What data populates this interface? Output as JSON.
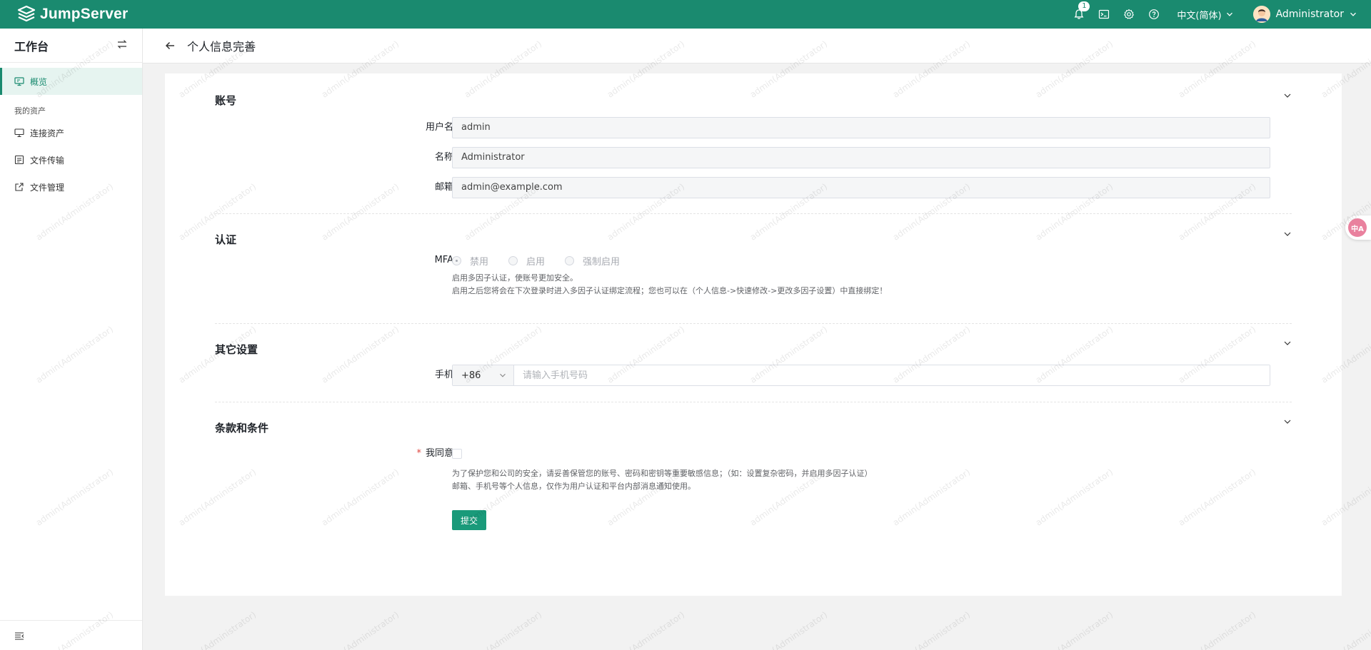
{
  "app": {
    "brand": "JumpServer",
    "accent_color": "#1a8a6f",
    "notification_count": "1",
    "language": "中文(简体)",
    "user_name": "Administrator",
    "icons": [
      "bell-icon",
      "terminal-icon",
      "gear-icon",
      "help-icon",
      "chevron-down-icon"
    ]
  },
  "sidebar": {
    "title": "工作台",
    "items": [
      {
        "label": "概览",
        "active": true,
        "icon": "monitor-icon"
      }
    ],
    "group_label": "我的资产",
    "group_items": [
      {
        "label": "连接资产",
        "icon": "desktop-icon"
      },
      {
        "label": "文件传输",
        "icon": "file-transfer-icon"
      },
      {
        "label": "文件管理",
        "icon": "external-link-icon"
      }
    ]
  },
  "page": {
    "title": "个人信息完善"
  },
  "sections": {
    "account": {
      "title": "账号",
      "username_label": "用户名",
      "username_value": "admin",
      "name_label": "名称",
      "name_value": "Administrator",
      "email_label": "邮箱",
      "email_value": "admin@example.com"
    },
    "auth": {
      "title": "认证",
      "mfa_label": "MFA",
      "options": [
        "禁用",
        "启用",
        "强制启用"
      ],
      "selected": "禁用",
      "help_line1": "启用多因子认证，使账号更加安全。",
      "help_line2": "启用之后您将会在下次登录时进入多因子认证绑定流程；您也可以在（个人信息->快速修改->更改多因子设置）中直接绑定！"
    },
    "other": {
      "title": "其它设置",
      "phone_label": "手机",
      "country_code": "+86",
      "phone_placeholder": "请输入手机号码"
    },
    "terms": {
      "title": "条款和条件",
      "agree_required_mark": "*",
      "agree_label": "我同意",
      "agree_checked": false,
      "help_line1": "为了保护您和公司的安全，请妥善保管您的账号、密码和密钥等重要敏感信息；（如：设置复杂密码，并启用多因子认证）",
      "help_line2": "邮箱、手机号等个人信息，仅作为用户认证和平台内部消息通知使用。"
    }
  },
  "actions": {
    "submit_label": "提交"
  },
  "float": {
    "translate_label": "中A"
  },
  "watermark_text": "admin(Administrator)"
}
